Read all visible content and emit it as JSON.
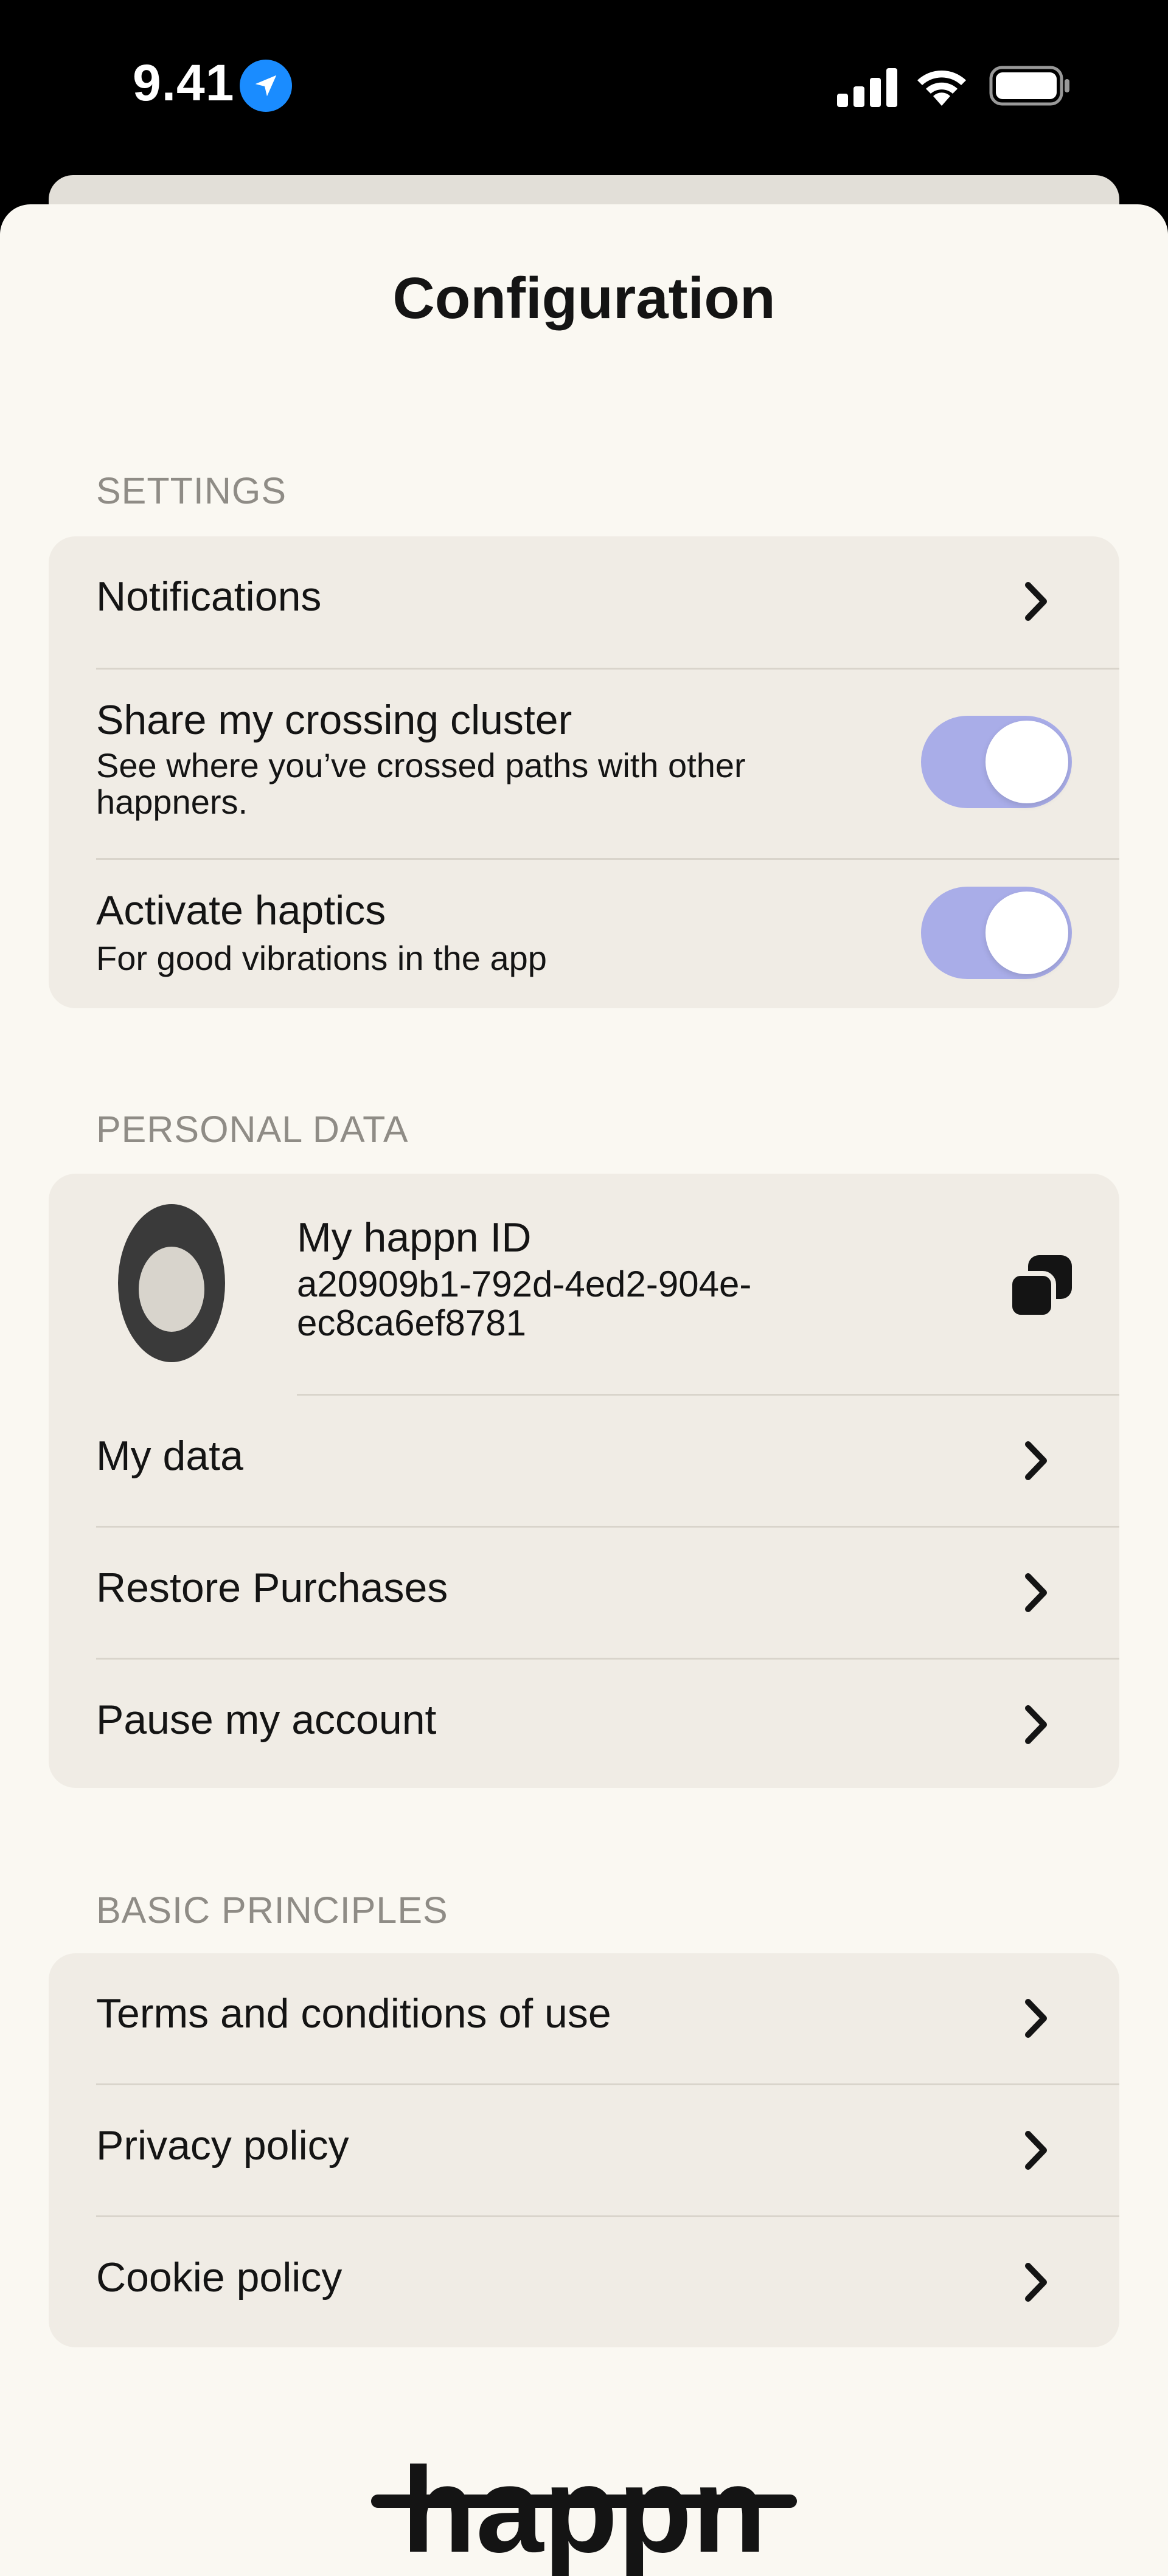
{
  "status_bar": {
    "time": "9.41"
  },
  "title": "Configuration",
  "settings": {
    "label": "SETTINGS",
    "notifications": "Notifications",
    "crossing_title": "Share my crossing cluster",
    "crossing_sub": "See where you’ve crossed paths with other happners.",
    "crossing_enabled": true,
    "haptics_title": "Activate haptics",
    "haptics_sub": "For good vibrations in the app",
    "haptics_enabled": true
  },
  "personal": {
    "label": "PERSONAL DATA",
    "id_title": "My happn ID",
    "id_line1": "a20909b1-792d-4ed2-904e-",
    "id_line2": "ec8ca6ef8781",
    "my_data": "My data",
    "restore": "Restore Purchases",
    "pause": "Pause my account"
  },
  "principles": {
    "label": "BASIC PRINCIPLES",
    "terms": "Terms and conditions of use",
    "privacy": "Privacy policy",
    "cookie": "Cookie policy"
  },
  "brand": {
    "logo_text": "happn"
  },
  "colors": {
    "toggle_on": "#a9ade8",
    "location": "#1a8cff",
    "sheet": "#faf8f2",
    "card": "#f0ece5"
  },
  "icons": [
    "location-arrow-icon",
    "signal-icon",
    "wifi-icon",
    "battery-icon",
    "chevron-right-icon",
    "copy-icon"
  ]
}
